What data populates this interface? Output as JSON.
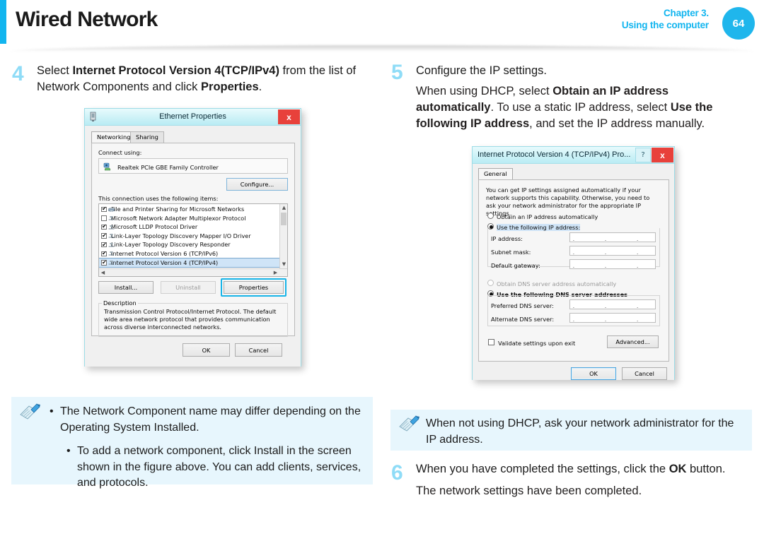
{
  "header": {
    "title": "Wired Network",
    "chapter": "Chapter 3.",
    "chapter_sub": "Using the computer",
    "page_number": "64",
    "accent_color": "#12b5ef"
  },
  "steps": {
    "step4": {
      "number": "4",
      "line1_pre": "Select ",
      "line1_bold": "Internet Protocol Version 4(TCP/IPv4)",
      "line1_post": " from the list of Network Components and click ",
      "line1_bold2": "Properties",
      "line1_end": "."
    },
    "step5": {
      "number": "5",
      "line1": "Configure the IP settings.",
      "sub_pre": "When using DHCP, select ",
      "sub_bold1": "Obtain an IP address automatically",
      "sub_mid": ". To use a static IP address, select ",
      "sub_bold2": "Use the following IP address",
      "sub_end": ", and set the IP address manually."
    },
    "step6": {
      "number": "6",
      "line1_pre": "When you have completed the settings, click the ",
      "line1_bold": "OK",
      "line1_post": " button.",
      "sub": "The network settings have been completed."
    }
  },
  "ethernet_dialog": {
    "title": "Ethernet Properties",
    "close_label": "x",
    "tabs": [
      {
        "label": "Networking",
        "active": true
      },
      {
        "label": "Sharing",
        "active": false
      }
    ],
    "connect_using_label": "Connect using:",
    "adapter_name": "Realtek PCIe GBE Family Controller",
    "configure_button": "Configure...",
    "items_label": "This connection uses the following items:",
    "components": [
      {
        "label": "File and Printer Sharing for Microsoft Networks",
        "checked": true,
        "selected": false,
        "icon": "printer-icon"
      },
      {
        "label": "Microsoft Network Adapter Multiplexor Protocol",
        "checked": false,
        "selected": false,
        "icon": "protocol-icon"
      },
      {
        "label": "Microsoft LLDP Protocol Driver",
        "checked": true,
        "selected": false,
        "icon": "protocol-icon"
      },
      {
        "label": "Link-Layer Topology Discovery Mapper I/O Driver",
        "checked": true,
        "selected": false,
        "icon": "protocol-icon"
      },
      {
        "label": "Link-Layer Topology Discovery Responder",
        "checked": true,
        "selected": false,
        "icon": "protocol-icon"
      },
      {
        "label": "Internet Protocol Version 6 (TCP/IPv6)",
        "checked": true,
        "selected": false,
        "icon": "protocol-icon"
      },
      {
        "label": "Internet Protocol Version 4 (TCP/IPv4)",
        "checked": true,
        "selected": true,
        "icon": "protocol-icon"
      }
    ],
    "install_button": "Install...",
    "uninstall_button": "Uninstall",
    "properties_button": "Properties",
    "description_title": "Description",
    "description_text": "Transmission Control Protocol/Internet Protocol. The default wide area network protocol that provides communication across diverse interconnected networks.",
    "ok_button": "OK",
    "cancel_button": "Cancel"
  },
  "tcpip_dialog": {
    "title": "Internet Protocol Version 4 (TCP/IPv4) Pro...",
    "help_label": "?",
    "close_label": "x",
    "tabs": [
      {
        "label": "General",
        "active": true
      }
    ],
    "intro_text": "You can get IP settings assigned automatically if your network supports this capability. Otherwise, you need to ask your network administrator for the appropriate IP settings.",
    "radio_obtain_ip": "Obtain an IP address automatically",
    "radio_use_ip": "Use the following IP address:",
    "ip_selected": "use_following",
    "fields": [
      {
        "label": "IP address:",
        "value": ""
      },
      {
        "label": "Subnet mask:",
        "value": ""
      },
      {
        "label": "Default gateway:",
        "value": ""
      }
    ],
    "radio_obtain_dns": "Obtain DNS server address automatically",
    "radio_use_dns": "Use the following DNS server addresses",
    "dns_selected": "use_following",
    "dns_fields": [
      {
        "label": "Preferred DNS server:",
        "value": ""
      },
      {
        "label": "Alternate DNS server:",
        "value": ""
      }
    ],
    "validate_checkbox": "Validate settings upon exit",
    "validate_checked": false,
    "advanced_button": "Advanced...",
    "ok_button": "OK",
    "cancel_button": "Cancel"
  },
  "notes": {
    "left": {
      "icon": "note-pen-icon",
      "items": [
        "The Network Component name may differ depending on the Operating System Installed.",
        "To add a network component, click Install in the screen shown in the figure above. You can add clients, services, and protocols."
      ],
      "bullet": "•"
    },
    "right": {
      "icon": "note-pen-icon",
      "text": "When not using DHCP, ask your network administrator for the IP address."
    }
  }
}
